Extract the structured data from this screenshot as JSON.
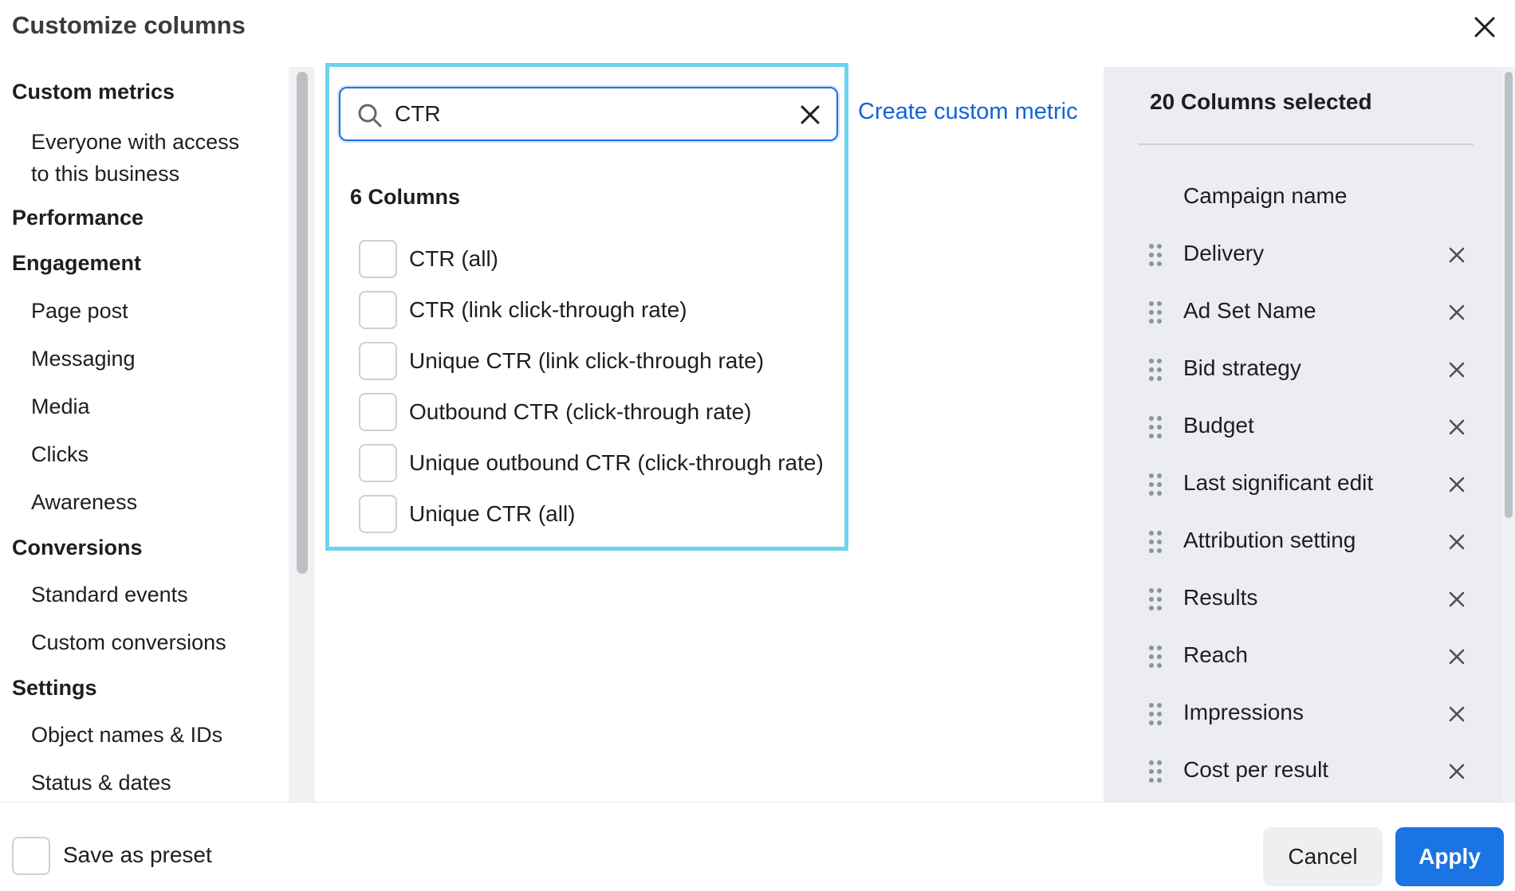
{
  "dialog": {
    "title": "Customize columns"
  },
  "left_nav": {
    "sections": [
      {
        "heading": "Custom metrics",
        "items": [
          "Everyone with access to this business"
        ]
      },
      {
        "heading": "Performance",
        "items": []
      },
      {
        "heading": "Engagement",
        "items": [
          "Page post",
          "Messaging",
          "Media",
          "Clicks",
          "Awareness"
        ]
      },
      {
        "heading": "Conversions",
        "items": [
          "Standard events",
          "Custom conversions"
        ]
      },
      {
        "heading": "Settings",
        "items": [
          "Object names & IDs",
          "Status & dates"
        ]
      }
    ],
    "custom_metrics_item_line1": "Everyone with access",
    "custom_metrics_item_line2": "to this business"
  },
  "search": {
    "value": "CTR",
    "result_count": "6 Columns",
    "results": [
      {
        "label": "CTR (all)",
        "checked": false
      },
      {
        "label": "CTR (link click-through rate)",
        "checked": false
      },
      {
        "label": "Unique CTR (link click-through rate)",
        "checked": false
      },
      {
        "label": "Outbound CTR (click-through rate)",
        "checked": false
      },
      {
        "label": "Unique outbound CTR (click-through rate)",
        "checked": false
      },
      {
        "label": "Unique CTR (all)",
        "checked": false
      }
    ]
  },
  "create_custom_metric": "Create custom metric",
  "selected": {
    "count_label": "20 Columns selected",
    "fixed": "Campaign name",
    "columns": [
      "Delivery",
      "Ad Set Name",
      "Bid strategy",
      "Budget",
      "Last significant edit",
      "Attribution setting",
      "Results",
      "Reach",
      "Impressions",
      "Cost per result"
    ]
  },
  "footer": {
    "save_preset": "Save as preset",
    "cancel": "Cancel",
    "apply": "Apply"
  },
  "colors": {
    "accent": "#1b74e4",
    "link": "#1264d8",
    "highlight_border": "#6ad4ee",
    "panel_bg": "#ebedf0"
  },
  "icons": {
    "close": "close-icon",
    "search": "search-icon",
    "clear": "clear-icon",
    "drag": "drag-handle-icon",
    "remove": "remove-icon"
  }
}
